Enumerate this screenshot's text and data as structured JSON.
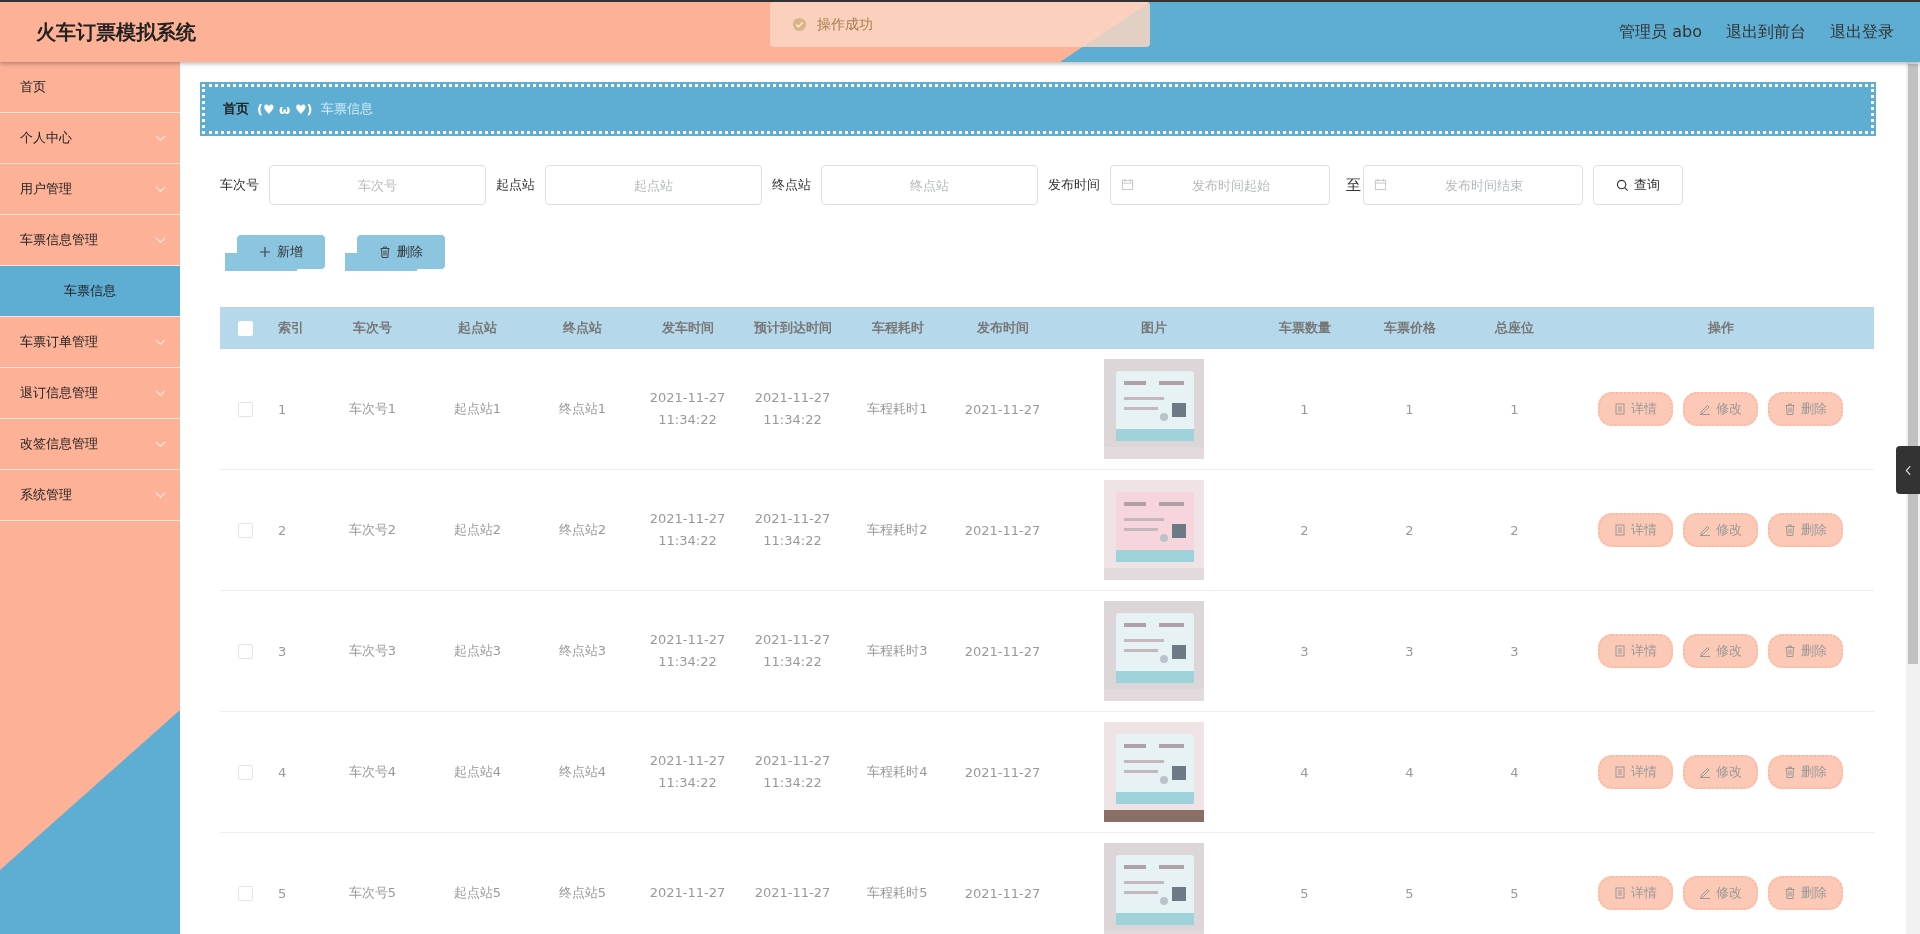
{
  "header": {
    "title": "火车订票模拟系统",
    "user": "管理员 abo",
    "links": [
      "退出到前台",
      "退出登录"
    ]
  },
  "toast": {
    "message": "操作成功"
  },
  "sidebar": {
    "items": [
      {
        "label": "首页",
        "selected": false
      },
      {
        "label": "个人中心",
        "selected": false
      },
      {
        "label": "用户管理",
        "selected": false
      },
      {
        "label": "车票信息管理",
        "selected": false,
        "children": [
          {
            "label": "车票信息",
            "selected": true
          }
        ]
      },
      {
        "label": "车票订单管理",
        "selected": false
      },
      {
        "label": "退订信息管理",
        "selected": false
      },
      {
        "label": "改签信息管理",
        "selected": false
      },
      {
        "label": "系统管理",
        "selected": false
      }
    ]
  },
  "breadcrumb": {
    "home": "首页",
    "separator": "(♥ ω ♥)",
    "current": "车票信息"
  },
  "search": {
    "fields": [
      {
        "label": "车次号",
        "placeholder": "车次号",
        "kind": "text"
      },
      {
        "label": "起点站",
        "placeholder": "起点站",
        "kind": "text"
      },
      {
        "label": "终点站",
        "placeholder": "终点站",
        "kind": "text"
      },
      {
        "label": "发布时间",
        "placeholder": "发布时间起始",
        "kind": "date"
      },
      {
        "label": "至",
        "placeholder": "发布时间结束",
        "kind": "date"
      }
    ],
    "button": "查询"
  },
  "toolbar": [
    {
      "label": "新增",
      "kind": "add"
    },
    {
      "label": "删除",
      "kind": "delete"
    }
  ],
  "table": {
    "all_checked": false,
    "columns": [
      "索引",
      "车次号",
      "起点站",
      "终点站",
      "发车时间",
      "预计到达时间",
      "车程耗时",
      "发布时间",
      "图片",
      "车票数量",
      "车票价格",
      "总座位",
      "操作"
    ],
    "rows": [
      {
        "checked": false,
        "index": "1",
        "train": "车次号1",
        "from": "起点站1",
        "to": "终点站1",
        "depart": [
          "2021-11-27",
          "11:34:22"
        ],
        "arrive": [
          "2021-11-27",
          "11:34:22"
        ],
        "duration": "车程耗时1",
        "published": "2021-11-27",
        "image": {
          "kind": "picture"
        },
        "quantity": "1",
        "price": "1",
        "seats": "1",
        "actions": [
          {
            "label": "详情",
            "kind": "detail"
          },
          {
            "label": "修改",
            "kind": "edit"
          },
          {
            "label": "删除",
            "kind": "delete"
          }
        ]
      },
      {
        "checked": false,
        "index": "2",
        "train": "车次号2",
        "from": "起点站2",
        "to": "终点站2",
        "depart": [
          "2021-11-27",
          "11:34:22"
        ],
        "arrive": [
          "2021-11-27",
          "11:34:22"
        ],
        "duration": "车程耗时2",
        "published": "2021-11-27",
        "image": {
          "kind": "picture"
        },
        "quantity": "2",
        "price": "2",
        "seats": "2",
        "actions": [
          {
            "label": "详情",
            "kind": "detail"
          },
          {
            "label": "修改",
            "kind": "edit"
          },
          {
            "label": "删除",
            "kind": "delete"
          }
        ]
      },
      {
        "checked": false,
        "index": "3",
        "train": "车次号3",
        "from": "起点站3",
        "to": "终点站3",
        "depart": [
          "2021-11-27",
          "11:34:22"
        ],
        "arrive": [
          "2021-11-27",
          "11:34:22"
        ],
        "duration": "车程耗时3",
        "published": "2021-11-27",
        "image": {
          "kind": "picture"
        },
        "quantity": "3",
        "price": "3",
        "seats": "3",
        "actions": [
          {
            "label": "详情",
            "kind": "detail"
          },
          {
            "label": "修改",
            "kind": "edit"
          },
          {
            "label": "删除",
            "kind": "delete"
          }
        ]
      },
      {
        "checked": false,
        "index": "4",
        "train": "车次号4",
        "from": "起点站4",
        "to": "终点站4",
        "depart": [
          "2021-11-27",
          "11:34:22"
        ],
        "arrive": [
          "2021-11-27",
          "11:34:22"
        ],
        "duration": "车程耗时4",
        "published": "2021-11-27",
        "image": {
          "kind": "picture"
        },
        "quantity": "4",
        "price": "4",
        "seats": "4",
        "actions": [
          {
            "label": "详情",
            "kind": "detail"
          },
          {
            "label": "修改",
            "kind": "edit"
          },
          {
            "label": "删除",
            "kind": "delete"
          }
        ]
      },
      {
        "checked": false,
        "index": "5",
        "train": "车次号5",
        "from": "起点站5",
        "to": "终点站5",
        "depart": [
          "2021-11-27"
        ],
        "arrive": [
          "2021-11-27"
        ],
        "duration": "车程耗时5",
        "published": "2021-11-27",
        "image": {
          "kind": "picture"
        },
        "quantity": "5",
        "price": "5",
        "seats": "5",
        "actions": [
          {
            "label": "详情",
            "kind": "detail"
          },
          {
            "label": "修改",
            "kind": "edit"
          },
          {
            "label": "删除",
            "kind": "delete"
          }
        ]
      }
    ]
  }
}
